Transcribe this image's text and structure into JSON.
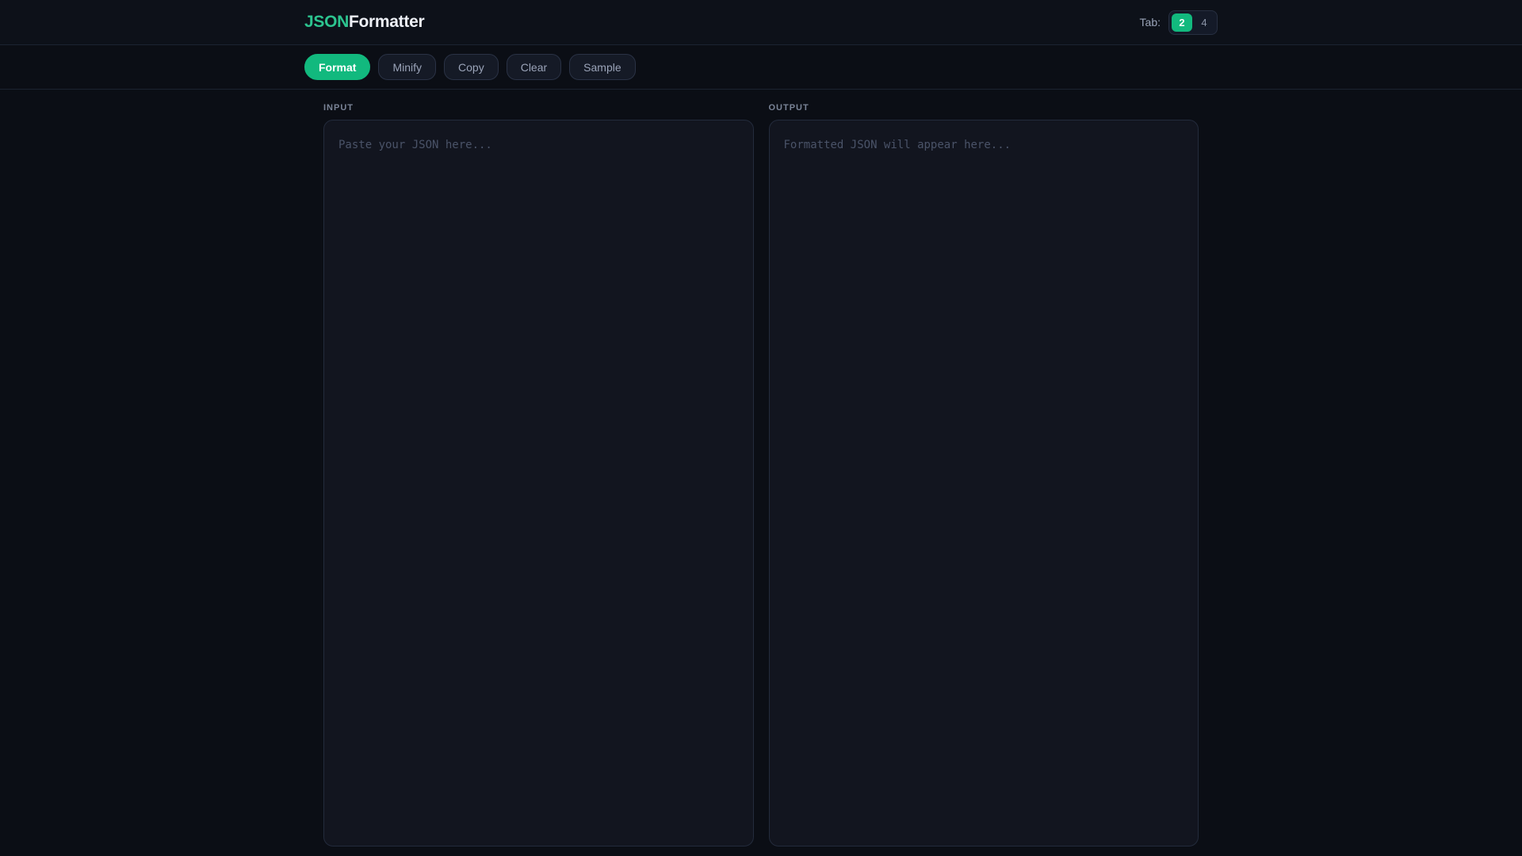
{
  "header": {
    "logo": {
      "accent": "JSON",
      "rest": "Formatter"
    },
    "tab_control": {
      "label": "Tab:",
      "options": [
        {
          "label": "2",
          "active": true
        },
        {
          "label": "4",
          "active": false
        }
      ]
    }
  },
  "toolbar": {
    "buttons": [
      {
        "label": "Format",
        "variant": "primary"
      },
      {
        "label": "Minify",
        "variant": "secondary"
      },
      {
        "label": "Copy",
        "variant": "secondary"
      },
      {
        "label": "Clear",
        "variant": "secondary"
      },
      {
        "label": "Sample",
        "variant": "secondary"
      }
    ]
  },
  "panels": {
    "input": {
      "title": "INPUT",
      "value": "",
      "placeholder": "Paste your JSON here..."
    },
    "output": {
      "title": "OUTPUT",
      "value": "",
      "placeholder": "Formatted JSON will appear here..."
    }
  },
  "colors": {
    "accent_green": "#12b97e",
    "logo_green": "#2cc48f",
    "page_background": "#0b0e15",
    "panel_background": "#12151f"
  }
}
